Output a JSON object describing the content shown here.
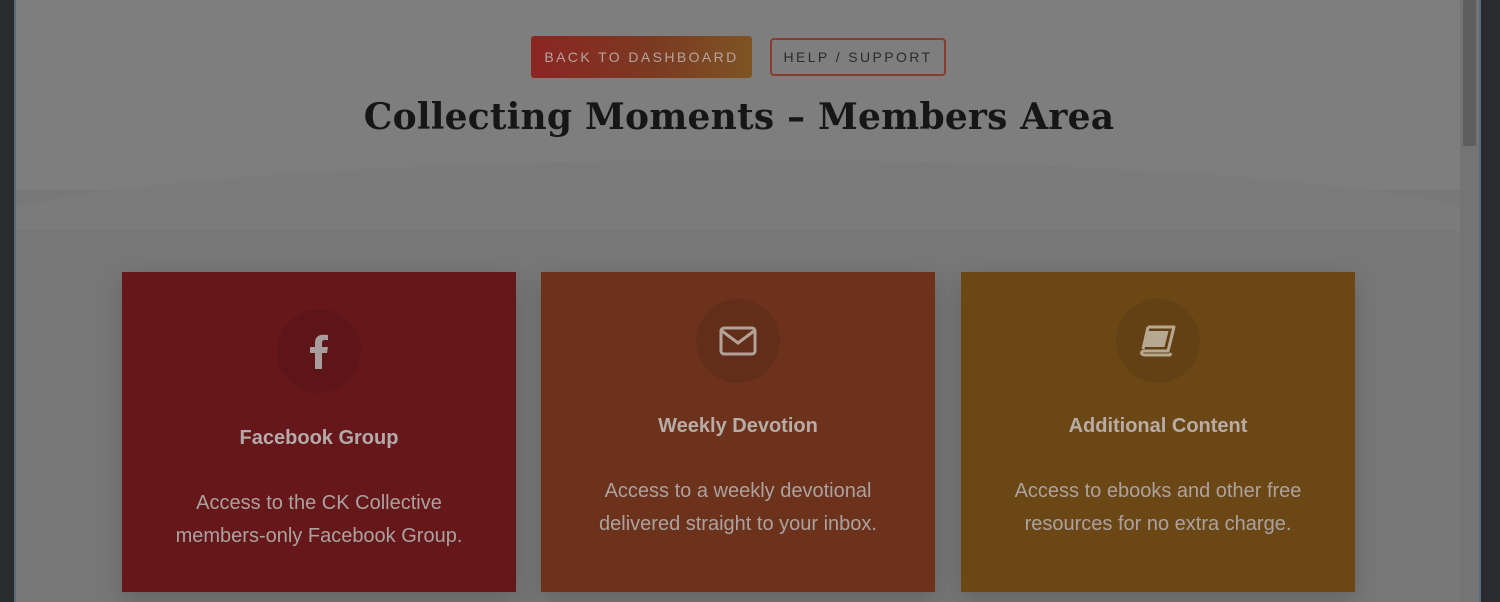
{
  "header": {
    "back_button_label": "BACK TO DASHBOARD",
    "help_button_label": "HELP / SUPPORT",
    "title": "Collecting Moments – Members Area"
  },
  "cards": [
    {
      "icon": "facebook-icon",
      "title": "Facebook Group",
      "description": "Access to the CK Collective members-only Facebook Group.",
      "color": "#65171a"
    },
    {
      "icon": "envelope-icon",
      "title": "Weekly Devotion",
      "description": "Access to a weekly devotional delivered straight to your inbox.",
      "color": "#6c321c"
    },
    {
      "icon": "book-icon",
      "title": "Additional Content",
      "description": "Access to ebooks and other free resources for no extra charge.",
      "color": "#6c4716"
    }
  ]
}
